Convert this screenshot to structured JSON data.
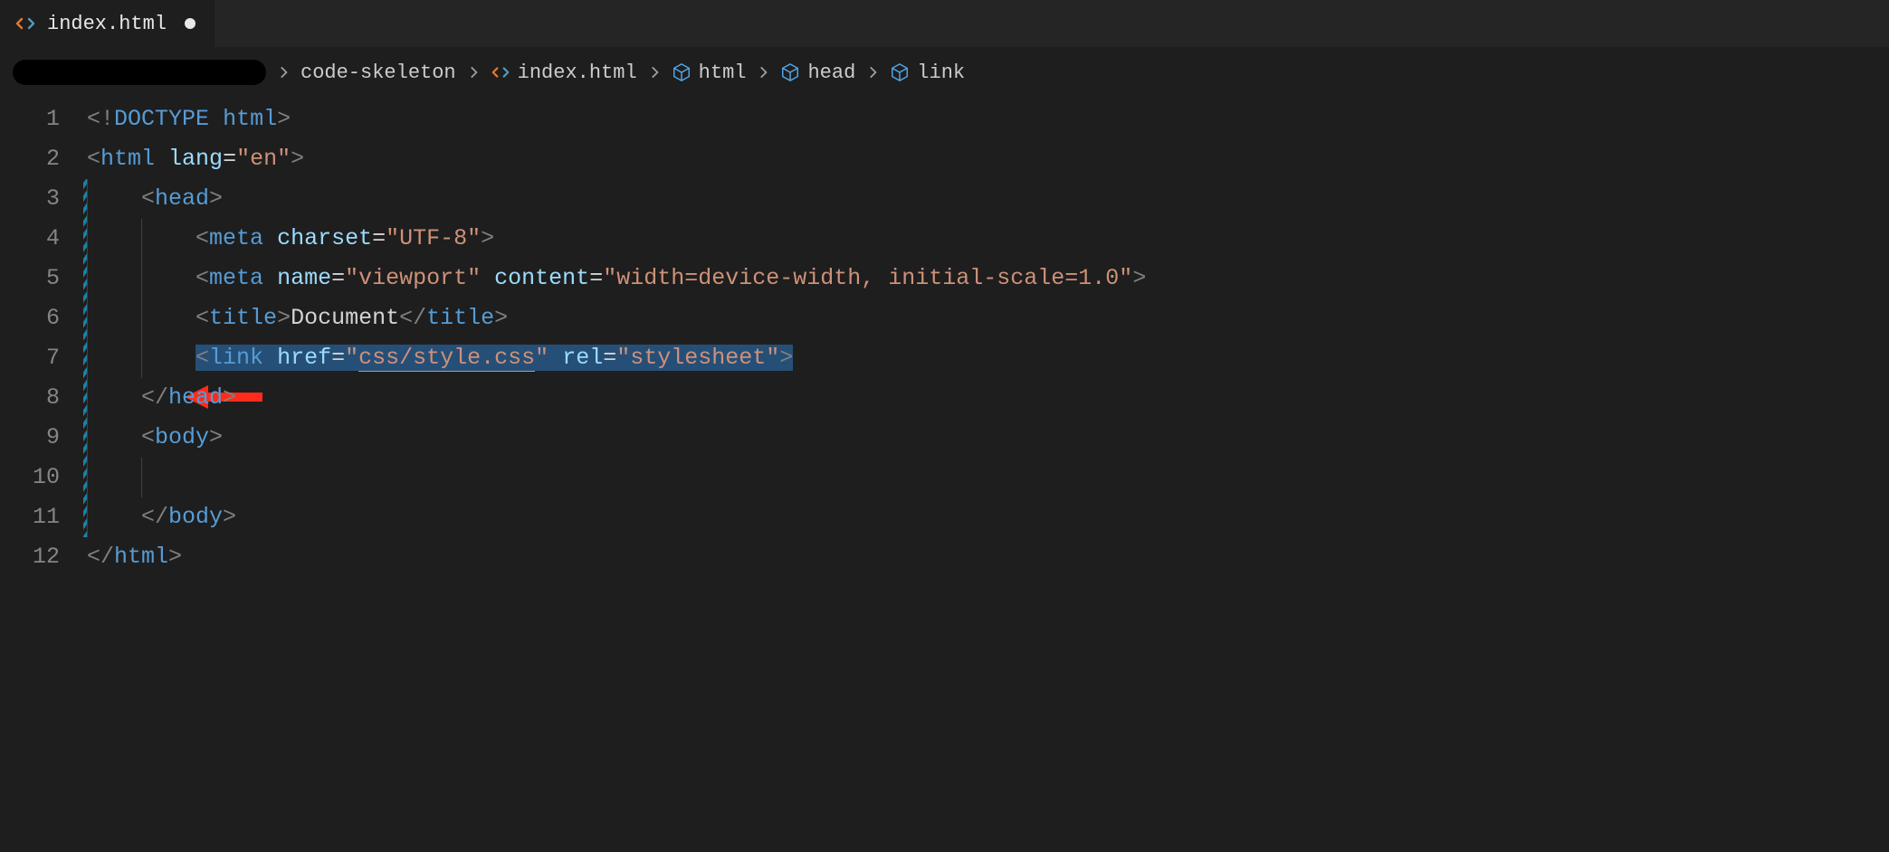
{
  "tab": {
    "label": "index.html",
    "dirty": true
  },
  "breadcrumb": {
    "items": [
      "code-skeleton",
      "index.html",
      "html",
      "head",
      "link"
    ]
  },
  "lines": [
    "1",
    "2",
    "3",
    "4",
    "5",
    "6",
    "7",
    "8",
    "9",
    "10",
    "11",
    "12"
  ],
  "tokens": {
    "l1": {
      "a": "<!",
      "b": "DOCTYPE",
      "c": " ",
      "d": "html",
      "e": ">"
    },
    "l2": {
      "a": "<",
      "b": "html",
      "c": " ",
      "d": "lang",
      "e": "=",
      "f": "\"en\"",
      "g": ">"
    },
    "l3": {
      "a": "<",
      "b": "head",
      "c": ">"
    },
    "l4": {
      "a": "<",
      "b": "meta",
      "c": " ",
      "d": "charset",
      "e": "=",
      "f": "\"UTF-8\"",
      "g": ">"
    },
    "l5": {
      "a": "<",
      "b": "meta",
      "c": " ",
      "d": "name",
      "e": "=",
      "f": "\"viewport\"",
      "g": " ",
      "h": "content",
      "i": "=",
      "j": "\"width=device-width, initial-scale=1.0\"",
      "k": ">"
    },
    "l6": {
      "a": "<",
      "b": "title",
      "c": ">",
      "d": "Document",
      "e": "</",
      "f": "title",
      "g": ">"
    },
    "l7": {
      "a": "<",
      "b": "link",
      "c": " ",
      "d": "href",
      "e": "=",
      "f": "\"",
      "g": "css/style.css",
      "h": "\"",
      "i": " ",
      "j": "rel",
      "k": "=",
      "l": "\"stylesheet\"",
      "m": ">"
    },
    "l8": {
      "a": "</",
      "b": "head",
      "c": ">"
    },
    "l9": {
      "a": "<",
      "b": "body",
      "c": ">"
    },
    "l11": {
      "a": "</",
      "b": "body",
      "c": ">"
    },
    "l12": {
      "a": "</",
      "b": "html",
      "c": ">"
    }
  }
}
